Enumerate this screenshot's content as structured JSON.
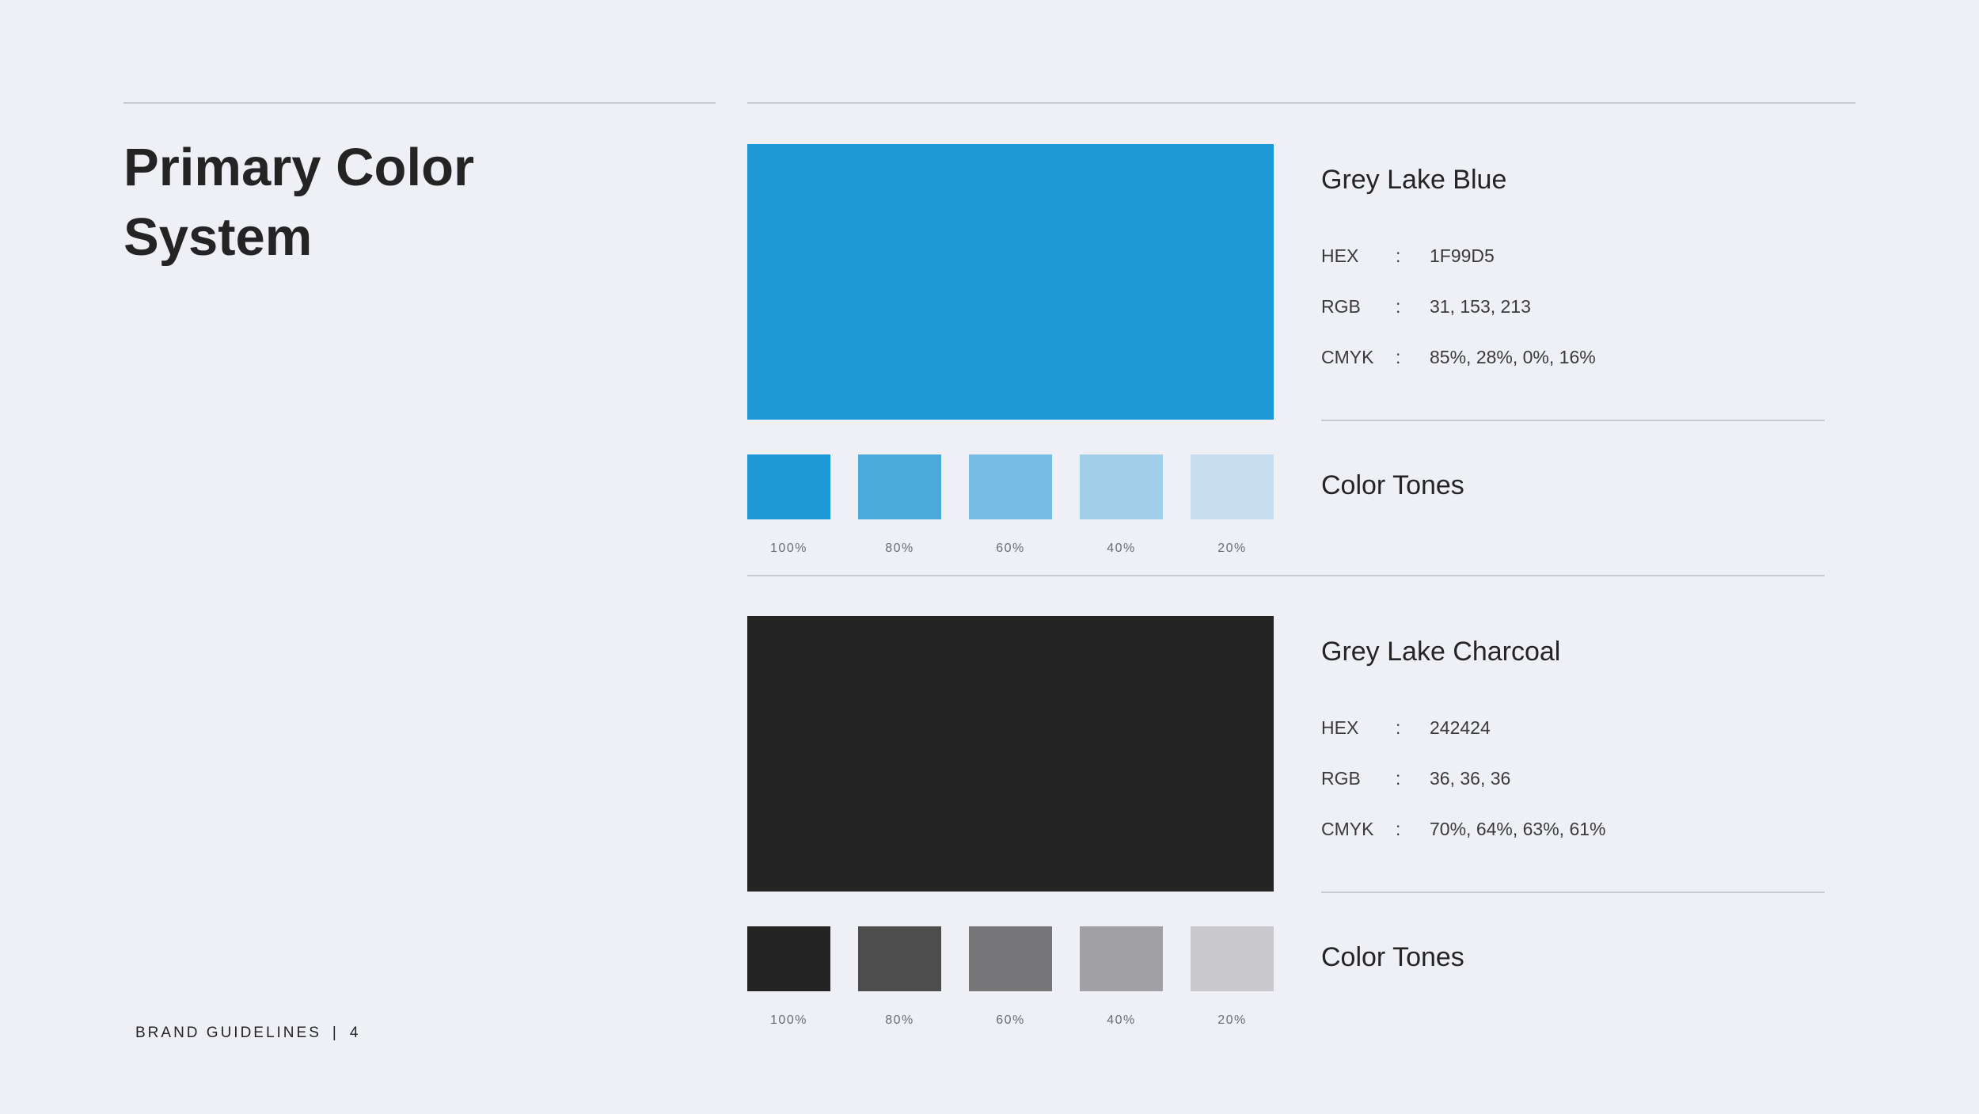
{
  "page": {
    "title_line1": "Primary Color",
    "title_line2": "System",
    "footer_label": "BRAND GUIDELINES",
    "footer_separator": "|",
    "page_number": "4"
  },
  "palettes": [
    {
      "name": "Grey Lake Blue",
      "main_color": "#1f99d5",
      "specs": [
        {
          "key": "HEX",
          "sep": ":",
          "value": "1F99D5"
        },
        {
          "key": "RGB",
          "sep": ":",
          "value": "31, 153, 213"
        },
        {
          "key": "CMYK",
          "sep": ":",
          "value": "85%, 28%, 0%, 16%"
        }
      ],
      "tones_heading": "Color Tones",
      "tones": [
        {
          "label": "100%",
          "color": "#1f99d5"
        },
        {
          "label": "80%",
          "color": "#4aaadc"
        },
        {
          "label": "60%",
          "color": "#77bde3"
        },
        {
          "label": "40%",
          "color": "#a1cfea"
        },
        {
          "label": "20%",
          "color": "#c7def0"
        }
      ]
    },
    {
      "name": "Grey Lake Charcoal",
      "main_color": "#242424",
      "specs": [
        {
          "key": "HEX",
          "sep": ":",
          "value": "242424"
        },
        {
          "key": "RGB",
          "sep": ":",
          "value": "36, 36, 36"
        },
        {
          "key": "CMYK",
          "sep": ":",
          "value": "70%, 64%, 63%, 61%"
        }
      ],
      "tones_heading": "Color Tones",
      "tones": [
        {
          "label": "100%",
          "color": "#242424"
        },
        {
          "label": "80%",
          "color": "#4d4d4e"
        },
        {
          "label": "60%",
          "color": "#77777a"
        },
        {
          "label": "40%",
          "color": "#a1a1a5"
        },
        {
          "label": "20%",
          "color": "#c8c8cd"
        }
      ]
    }
  ]
}
